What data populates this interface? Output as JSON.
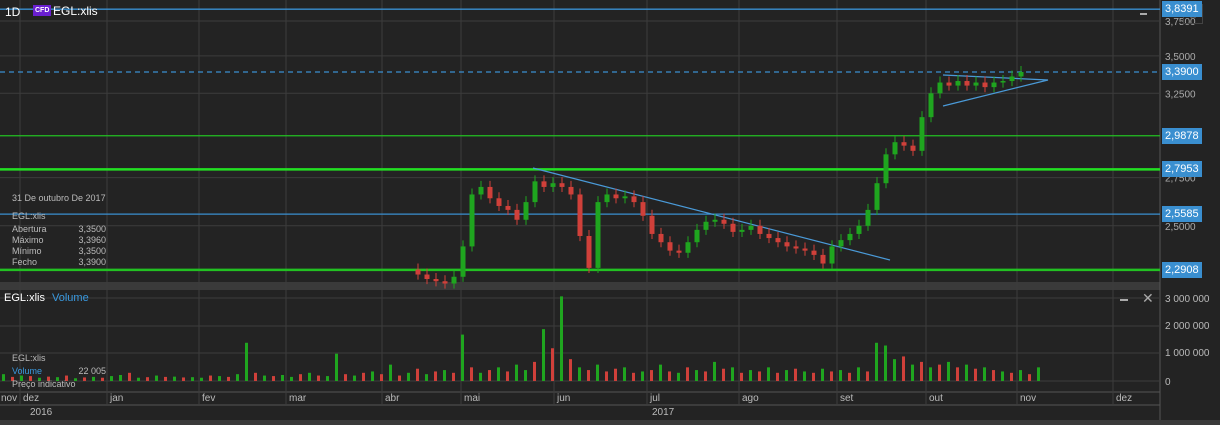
{
  "header": {
    "interval": "1D",
    "badge": "CFD",
    "symbol": "EGL:xlis"
  },
  "price_axis": {
    "ticks": [
      3.75,
      3.5,
      3.25,
      2.75,
      2.5
    ],
    "tick_labels": [
      "3,7500",
      "3,5000",
      "3,2500",
      "2,7500",
      "2,5000"
    ]
  },
  "levels": [
    {
      "value": 3.8391,
      "label": "3,8391",
      "color": "#3a8fd0",
      "style": "solid"
    },
    {
      "value": 3.39,
      "label": "3,3900",
      "color": "#3a8fd0",
      "style": "dashed"
    },
    {
      "value": 2.9878,
      "label": "2,9878",
      "color": "#22c022",
      "style": "solid"
    },
    {
      "value": 2.7953,
      "label": "2,7953",
      "color": "#22e022",
      "style": "thick"
    },
    {
      "value": 2.5585,
      "label": "2,5585",
      "color": "#3a8fd0",
      "style": "solid"
    },
    {
      "value": 2.2908,
      "label": "2,2908",
      "color": "#22c022",
      "style": "thick"
    }
  ],
  "tooltip": {
    "date": "31 De outubro De 2017",
    "symbol": "EGL:xlis",
    "rows": [
      {
        "label": "Abertura",
        "value": "3,3500"
      },
      {
        "label": "Máximo",
        "value": "3,3960"
      },
      {
        "label": "Mínimo",
        "value": "3,3500"
      },
      {
        "label": "Fecho",
        "value": "3,3900"
      }
    ]
  },
  "volume_panel": {
    "symbol": "EGL:xlis",
    "title": "Volume",
    "ticks": [
      "3 000 000",
      "2 000 000",
      "1 000 000",
      "0"
    ],
    "legend": {
      "symbol": "EGL:xlis",
      "label": "Volume",
      "value": "22 005",
      "note": "Preço indicativo"
    }
  },
  "time_axis": {
    "months": [
      "nov",
      "dez",
      "jan",
      "fev",
      "mar",
      "abr",
      "mai",
      "jun",
      "jul",
      "ago",
      "set",
      "out",
      "nov",
      "dez"
    ],
    "years": [
      "2016",
      "2017"
    ]
  },
  "colors": {
    "up": "#1fa51f",
    "down": "#d0403a",
    "accent": "#3a8fd0"
  },
  "chart_data": {
    "type": "candlestick",
    "scale": "log",
    "closes": [
      2.27,
      2.25,
      2.24,
      2.23,
      2.26,
      2.4,
      2.66,
      2.7,
      2.64,
      2.6,
      2.58,
      2.53,
      2.62,
      2.73,
      2.7,
      2.72,
      2.7,
      2.66,
      2.45,
      2.3,
      2.62,
      2.66,
      2.64,
      2.65,
      2.62,
      2.55,
      2.46,
      2.42,
      2.38,
      2.37,
      2.42,
      2.48,
      2.52,
      2.53,
      2.51,
      2.47,
      2.48,
      2.5,
      2.46,
      2.44,
      2.42,
      2.4,
      2.39,
      2.38,
      2.36,
      2.32,
      2.4,
      2.43,
      2.46,
      2.5,
      2.58,
      2.72,
      2.88,
      2.95,
      2.93,
      2.9,
      3.1,
      3.25,
      3.32,
      3.3,
      3.33,
      3.3,
      3.32,
      3.29,
      3.32,
      3.33,
      3.36,
      3.39
    ],
    "volume_k": [
      250,
      -150,
      200,
      -180,
      120,
      -160,
      140,
      -200,
      100,
      -130,
      150,
      -120,
      180,
      220,
      -300,
      120,
      -140,
      200,
      -150,
      160,
      -130,
      140,
      120,
      -200,
      180,
      -150,
      250,
      1400,
      -300,
      200,
      -180,
      220,
      150,
      -250,
      300,
      -200,
      180,
      1000,
      -250,
      200,
      -300,
      350,
      -250,
      600,
      -200,
      300,
      -450,
      250,
      -350,
      400,
      -300,
      1700,
      -500,
      300,
      -400,
      500,
      -350,
      600,
      400,
      -700,
      1900,
      -1200,
      3100,
      -800,
      500,
      -400,
      600,
      -350,
      -450,
      500,
      -300,
      350,
      -400,
      600,
      -350,
      300,
      -500,
      400,
      -350,
      700,
      -450,
      500,
      -300,
      400,
      -350,
      500,
      -300,
      400,
      -450,
      350,
      -300,
      450,
      -350,
      400,
      -300,
      500,
      -350,
      1400,
      1300,
      800,
      -900,
      600,
      -700,
      500,
      -600,
      700,
      -500,
      600,
      -450,
      500,
      -400,
      350,
      -300,
      400,
      -250,
      500
    ]
  }
}
